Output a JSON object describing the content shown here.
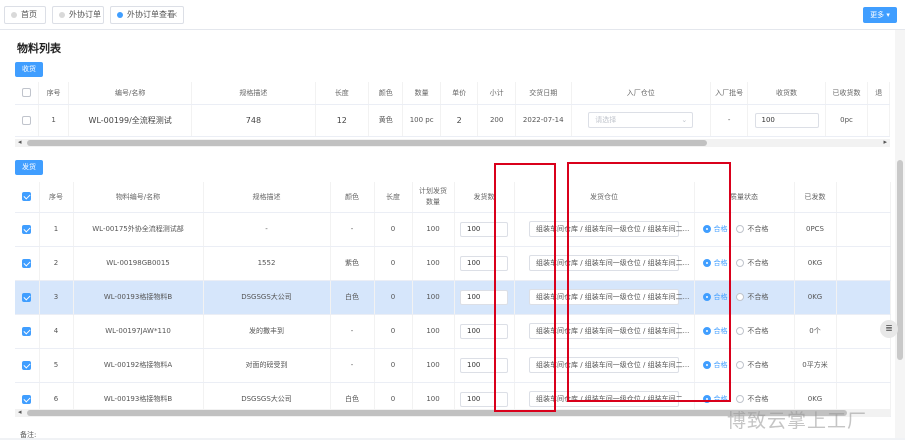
{
  "tabs": [
    {
      "label": "首页"
    },
    {
      "label": "外协订单"
    },
    {
      "label": "外协订单查看",
      "close": "×"
    }
  ],
  "more_label": "更多 ▾",
  "page_title": "物料列表",
  "receive_button": "收货",
  "ship_button": "发货",
  "receive_table": {
    "headers": [
      "序号",
      "编号/名称",
      "规格描述",
      "长度",
      "颜色",
      "数量",
      "单价",
      "小计",
      "交货日期",
      "入厂仓位",
      "入厂批号",
      "收货数",
      "已收货数",
      "退"
    ],
    "rows": [
      {
        "no": "1",
        "code": "WL-00199/全流程测试",
        "spec": "748",
        "length": "12",
        "color": "黄色",
        "qty": "100 pc",
        "price": "2",
        "subtotal": "200",
        "date": "2022-07-14",
        "warehouse_placeholder": "请选择",
        "batch": "-",
        "receive_qty": "100",
        "received": "0pc"
      }
    ]
  },
  "ship_table": {
    "headers": [
      "序号",
      "物料编号/名称",
      "规格描述",
      "颜色",
      "长度",
      "计划发货数量",
      "发货数",
      "发货仓位",
      "质量状态",
      "已发数"
    ],
    "rows": [
      {
        "no": "1",
        "code": "WL-00175外协全流程测试部",
        "spec": "-",
        "color": "-",
        "length": "0",
        "plan": "100",
        "ship": "100",
        "location": "组装车间仓库 / 组装车间一级仓位 / 组装车间二...",
        "good": "合格",
        "bad": "不合格",
        "sent": "0PCS",
        "highlight": false
      },
      {
        "no": "2",
        "code": "WL-00198GB0015",
        "spec": "1552",
        "color": "紫色",
        "length": "0",
        "plan": "100",
        "ship": "100",
        "location": "组装车间仓库 / 组装车间一级仓位 / 组装车间二...",
        "good": "合格",
        "bad": "不合格",
        "sent": "0KG",
        "highlight": false
      },
      {
        "no": "3",
        "code": "WL-00193格接物料B",
        "spec": "DSGSGS大公司",
        "color": "白色",
        "length": "0",
        "plan": "100",
        "ship": "100",
        "location": "组装车间仓库 / 组装车间一级仓位 / 组装车间二...",
        "good": "合格",
        "bad": "不合格",
        "sent": "0KG",
        "highlight": true
      },
      {
        "no": "4",
        "code": "WL-00197JAW*110",
        "spec": "发的撒丰到",
        "color": "-",
        "length": "0",
        "plan": "100",
        "ship": "100",
        "location": "组装车间仓库 / 组装车间一级仓位 / 组装车间二...",
        "good": "合格",
        "bad": "不合格",
        "sent": "0个",
        "highlight": false
      },
      {
        "no": "5",
        "code": "WL-00192格接物料A",
        "spec": "对面的磅受到",
        "color": "-",
        "length": "0",
        "plan": "100",
        "ship": "100",
        "location": "组装车间仓库 / 组装车间一级仓位 / 组装车间二...",
        "good": "合格",
        "bad": "不合格",
        "sent": "0平方米",
        "highlight": false
      },
      {
        "no": "6",
        "code": "WL-00193格接物料B",
        "spec": "DSGSGS大公司",
        "color": "白色",
        "length": "0",
        "plan": "100",
        "ship": "100",
        "location": "组装车间仓库 / 组装车间一级仓位 / 组装车间二...",
        "good": "合格",
        "bad": "不合格",
        "sent": "0KG",
        "highlight": false
      }
    ]
  },
  "remark_label": "备注:",
  "watermark": "博致云掌上工厂",
  "float_icon": "≣",
  "colors": {
    "accent": "#409eff",
    "highlight_row": "#d6e6fb",
    "annotation": "#d9001b"
  }
}
